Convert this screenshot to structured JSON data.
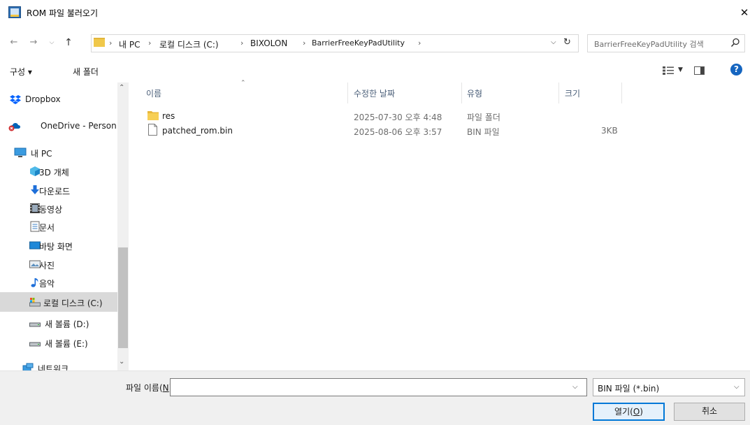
{
  "window": {
    "title": "ROM 파일 불러오기",
    "close_glyph": "✕",
    "colors": {
      "accent": "#0078d7",
      "help": "#1565c0",
      "folder": "#f0c84a"
    }
  },
  "address": {
    "breadcrumbs": [
      "내 PC",
      "로컬 디스크 (C:)",
      "BIXOLON",
      "BarrierFreeKeyPadUtility"
    ],
    "separator": "›",
    "search_placeholder": "BarrierFreeKeyPadUtility 검색"
  },
  "toolbar": {
    "organize": "구성 ▾",
    "new_folder": "새 폴더",
    "help": "?"
  },
  "nav": {
    "items": [
      {
        "label": "Dropbox",
        "icon": "dropbox-icon"
      },
      {
        "label": "OneDrive - Person",
        "icon": "onedrive-error-icon"
      },
      {
        "label": "내 PC",
        "icon": "pc-icon"
      },
      {
        "label": "3D 개체",
        "icon": "3d-objects-icon"
      },
      {
        "label": "다운로드",
        "icon": "download-icon"
      },
      {
        "label": "동영상",
        "icon": "video-icon"
      },
      {
        "label": "문서",
        "icon": "document-icon"
      },
      {
        "label": "바탕 화면",
        "icon": "desktop-icon"
      },
      {
        "label": "사진",
        "icon": "pictures-icon"
      },
      {
        "label": "음악",
        "icon": "music-icon"
      },
      {
        "label": "로컬 디스크 (C:)",
        "icon": "local-disk-icon",
        "selected": true
      },
      {
        "label": "새 볼륨 (D:)",
        "icon": "drive-icon"
      },
      {
        "label": "새 볼륨 (E:)",
        "icon": "drive-icon"
      },
      {
        "label": "네트워크",
        "icon": "network-icon"
      }
    ]
  },
  "files": {
    "columns": [
      "이름",
      "수정한 날짜",
      "유형",
      "크기"
    ],
    "rows": [
      {
        "name": "res",
        "date": "2025-07-30 오후 4:48",
        "type": "파일 폴더",
        "size": "",
        "icon": "folder-icon"
      },
      {
        "name": "patched_rom.bin",
        "date": "2025-08-06 오후 3:57",
        "type": "BIN 파일",
        "size": "3KB",
        "icon": "file-icon"
      }
    ]
  },
  "bottom": {
    "filename_label_pre": "파일 이름(",
    "filename_label_key": "N",
    "filename_label_post": "):",
    "filename_value": "",
    "filter_value": "BIN 파일 (*.bin)",
    "open_pre": "열기(",
    "open_key": "O",
    "open_post": ")",
    "cancel": "취소"
  }
}
